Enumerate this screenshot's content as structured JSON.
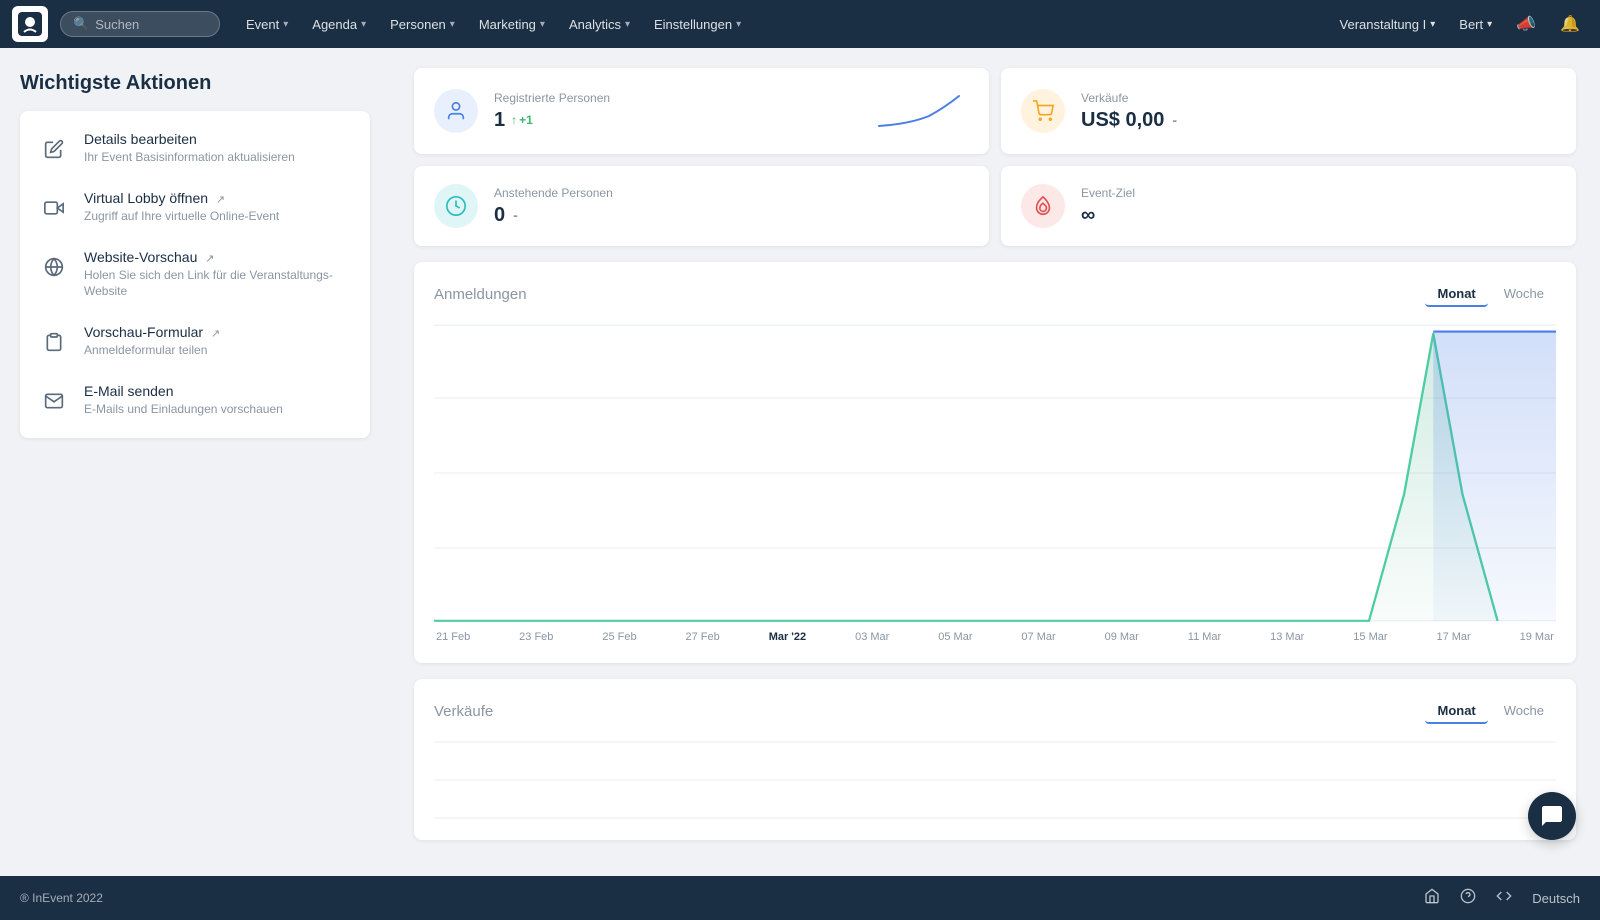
{
  "nav": {
    "search_placeholder": "Suchen",
    "items": [
      {
        "label": "Event",
        "id": "event"
      },
      {
        "label": "Agenda",
        "id": "agenda"
      },
      {
        "label": "Personen",
        "id": "personen"
      },
      {
        "label": "Marketing",
        "id": "marketing"
      },
      {
        "label": "Analytics",
        "id": "analytics"
      },
      {
        "label": "Einstellungen",
        "id": "einstellungen"
      }
    ],
    "veranstaltung_label": "Veranstaltung I",
    "user_label": "Bert"
  },
  "sidebar": {
    "title": "Wichtigste Aktionen",
    "actions": [
      {
        "id": "details",
        "title": "Details bearbeiten",
        "desc": "Ihr Event Basisinformation aktualisieren",
        "icon": "✏️",
        "external": false
      },
      {
        "id": "lobby",
        "title": "Virtual Lobby öffnen",
        "desc": "Zugriff auf Ihre virtuelle Online-Event",
        "icon": "🎥",
        "external": true
      },
      {
        "id": "website",
        "title": "Website-Vorschau",
        "desc": "Holen Sie sich den Link für die Veranstaltungs-Website",
        "icon": "🌐",
        "external": true
      },
      {
        "id": "form",
        "title": "Vorschau-Formular",
        "desc": "Anmeldeformular teilen",
        "icon": "📋",
        "external": true
      },
      {
        "id": "email",
        "title": "E-Mail senden",
        "desc": "E-Mails und Einladungen vorschauen",
        "icon": "✉️",
        "external": false
      }
    ]
  },
  "stats": [
    {
      "id": "registered",
      "label": "Registrierte Personen",
      "value": "1",
      "change": "+1",
      "change_icon": "↑",
      "icon_type": "blue",
      "has_chart": true
    },
    {
      "id": "sales",
      "label": "Verkäufe",
      "value": "US$ 0,00",
      "suffix": "-",
      "icon_type": "orange",
      "has_chart": false
    },
    {
      "id": "pending",
      "label": "Anstehende Personen",
      "value": "0",
      "suffix": "-",
      "icon_type": "teal",
      "has_chart": false
    },
    {
      "id": "goal",
      "label": "Event-Ziel",
      "value": "∞",
      "icon_type": "red",
      "has_chart": false
    }
  ],
  "charts": [
    {
      "id": "anmeldungen",
      "title": "Anmeldungen",
      "active_tab": "Monat",
      "tabs": [
        "Monat",
        "Woche"
      ],
      "x_labels": [
        {
          "label": "21 Feb",
          "bold": false
        },
        {
          "label": "23 Feb",
          "bold": false
        },
        {
          "label": "25 Feb",
          "bold": false
        },
        {
          "label": "27 Feb",
          "bold": false
        },
        {
          "label": "Mar '22",
          "bold": true
        },
        {
          "label": "03 Mar",
          "bold": false
        },
        {
          "label": "05 Mar",
          "bold": false
        },
        {
          "label": "07 Mar",
          "bold": false
        },
        {
          "label": "09 Mar",
          "bold": false
        },
        {
          "label": "11 Mar",
          "bold": false
        },
        {
          "label": "13 Mar",
          "bold": false
        },
        {
          "label": "15 Mar",
          "bold": false
        },
        {
          "label": "17 Mar",
          "bold": false
        },
        {
          "label": "19 Mar",
          "bold": false
        }
      ]
    },
    {
      "id": "verkaeufe",
      "title": "Verkäufe",
      "active_tab": "Monat",
      "tabs": [
        "Monat",
        "Woche"
      ],
      "x_labels": []
    }
  ],
  "footer": {
    "copyright": "® InEvent 2022",
    "lang": "Deutsch"
  },
  "chat_button": {
    "icon": "💬"
  }
}
